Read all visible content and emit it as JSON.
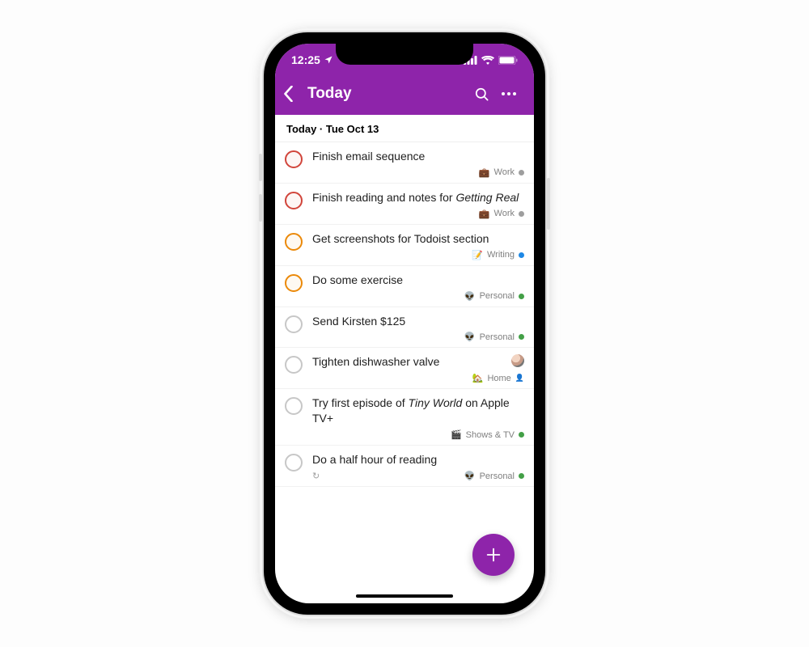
{
  "colors": {
    "accent": "#8e24aa",
    "priority_red": "#d1453b",
    "priority_orange": "#eb8909",
    "project_work": "#808080",
    "project_writing": "#1e88e5",
    "project_personal": "#43a047",
    "project_home": "#d1453b",
    "project_shows": "#43a047"
  },
  "status_bar": {
    "time": "12:25",
    "location_icon": "location-arrow",
    "signal_icon": "cellular",
    "wifi_icon": "wifi",
    "battery_icon": "battery-full"
  },
  "header": {
    "back_icon": "chevron-left",
    "title": "Today",
    "search_icon": "search",
    "more_icon": "more-horizontal"
  },
  "section": {
    "heading": "Today · Tue Oct 13"
  },
  "tasks": [
    {
      "title_html": "Finish email sequence",
      "priority": "red",
      "project": {
        "emoji": "💼",
        "name": "Work",
        "color": "#9e9e9e"
      },
      "recurring": false,
      "shared": false,
      "assignee_avatar": false
    },
    {
      "title_html": "Finish reading and notes for <em>Getting Real</em>",
      "priority": "red",
      "project": {
        "emoji": "💼",
        "name": "Work",
        "color": "#9e9e9e"
      },
      "recurring": false,
      "shared": false,
      "assignee_avatar": false
    },
    {
      "title_html": "Get screenshots for Todoist section",
      "priority": "orange",
      "project": {
        "emoji": "📝",
        "name": "Writing",
        "color": "#1e88e5"
      },
      "recurring": false,
      "shared": false,
      "assignee_avatar": false
    },
    {
      "title_html": "Do some exercise",
      "priority": "orange",
      "project": {
        "emoji": "👽",
        "name": "Personal",
        "color": "#43a047"
      },
      "recurring": false,
      "shared": false,
      "assignee_avatar": false
    },
    {
      "title_html": "Send Kirsten $125",
      "priority": "default",
      "project": {
        "emoji": "👽",
        "name": "Personal",
        "color": "#43a047"
      },
      "recurring": false,
      "shared": false,
      "assignee_avatar": false
    },
    {
      "title_html": "Tighten dishwasher valve",
      "priority": "default",
      "project": {
        "emoji": "🏡",
        "name": "Home",
        "color": "#d1453b"
      },
      "recurring": false,
      "shared": true,
      "assignee_avatar": true
    },
    {
      "title_html": "Try first episode of <em>Tiny World</em> on Apple TV+",
      "priority": "default",
      "project": {
        "emoji": "🎬",
        "name": "Shows & TV",
        "color": "#43a047"
      },
      "recurring": false,
      "shared": false,
      "assignee_avatar": false
    },
    {
      "title_html": "Do a half hour of reading",
      "priority": "default",
      "project": {
        "emoji": "👽",
        "name": "Personal",
        "color": "#43a047"
      },
      "recurring": true,
      "shared": false,
      "assignee_avatar": false
    }
  ],
  "fab": {
    "icon": "plus",
    "label": "Add task"
  }
}
